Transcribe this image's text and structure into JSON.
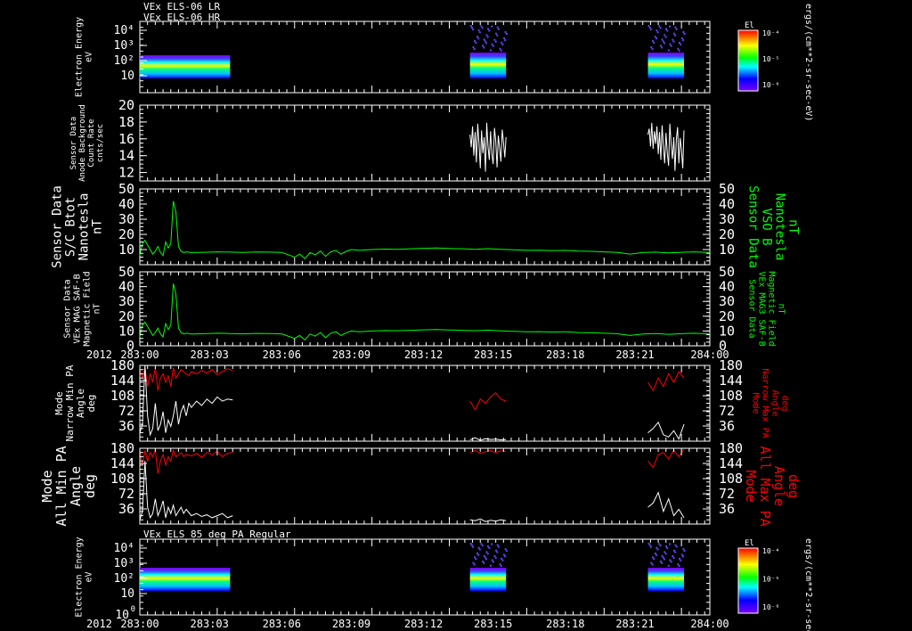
{
  "chart_data": [
    {
      "type": "heatmap",
      "titles": [
        "VEx ELS-06 LR",
        "VEx ELS-06 HR"
      ],
      "ylabel": [
        "Electron Energy",
        "eV"
      ],
      "yscale": "log",
      "yticks": [
        "10",
        "10²",
        "10³",
        "10⁴"
      ],
      "colorbar": {
        "label": "El",
        "ticks": [
          "10⁻⁴",
          "10⁻⁵",
          "10⁻⁶"
        ]
      },
      "colorbar_units": "ergs/(cm**2-sr-sec-eV)",
      "data_segments": [
        [
          0,
          35
        ],
        [
          128,
          142
        ],
        [
          197,
          211
        ]
      ]
    },
    {
      "type": "line",
      "ylabel": [
        "Sensor Data",
        "Anode Background",
        "Count Rate",
        "cnts/sec"
      ],
      "ylim": [
        11,
        20
      ],
      "yticks": [
        12,
        14,
        16,
        18,
        20
      ],
      "series": [
        {
          "color": "#ffffff",
          "x": [
            128,
            128.5,
            129,
            129.5,
            130,
            130.5,
            131,
            131.5,
            132,
            132.5,
            133,
            133.5,
            134,
            134.5,
            135,
            135.5,
            136,
            136.5,
            137,
            137.5,
            138,
            138.5,
            139,
            139.5,
            140,
            140.5,
            141,
            141.5,
            142
          ],
          "y": [
            16.5,
            15,
            17.5,
            14,
            16.8,
            13.2,
            17.8,
            15.5,
            12.5,
            17,
            14.3,
            16.2,
            12.1,
            17.9,
            15,
            13.5,
            16.9,
            14.2,
            13,
            17.3,
            15.8,
            12.6,
            16.4,
            14.9,
            13.3,
            17.1,
            15.6,
            13.8,
            16.2
          ]
        },
        {
          "color": "#ffffff",
          "x": [
            197,
            197.5,
            198,
            198.5,
            199,
            199.5,
            200,
            200.5,
            201,
            201.5,
            202,
            202.5,
            203,
            203.5,
            204,
            204.5,
            205,
            205.5,
            206,
            206.5,
            207,
            207.5,
            208,
            208.5,
            209,
            209.5,
            210,
            210.5,
            211
          ],
          "y": [
            16.5,
            17.2,
            15.1,
            17.9,
            14.8,
            16.9,
            15.4,
            17.5,
            14.2,
            16.8,
            13.5,
            17.6,
            15,
            13.1,
            16.7,
            14.4,
            12.8,
            17.8,
            15.3,
            13.6,
            16.2,
            12.2,
            15.9,
            17.4,
            13.1,
            16.1,
            14.7,
            12.5,
            17
          ]
        }
      ]
    },
    {
      "type": "line",
      "ylabel": [
        "Sensor Data",
        "S/C Btot",
        "Nanotesla",
        "nT"
      ],
      "ylabel_right": [
        "Sensor Data",
        "VSO B",
        "Nanotesla",
        "nT"
      ],
      "ylim": [
        0,
        50
      ],
      "yticks": [
        10,
        20,
        30,
        40,
        50
      ],
      "series": [
        {
          "color": "#00ff00",
          "x": [
            0,
            1,
            2,
            3,
            4,
            5,
            6,
            7,
            8,
            9,
            10,
            11,
            12,
            13,
            14,
            15,
            16,
            17,
            18,
            20,
            25,
            30,
            35,
            40,
            45,
            50,
            55,
            60,
            62,
            64,
            66,
            68,
            70,
            72,
            74,
            76,
            78,
            80,
            82,
            85,
            90,
            95,
            100,
            105,
            110,
            115,
            120,
            125,
            130,
            135,
            140,
            145,
            150,
            155,
            160,
            165,
            170,
            175,
            180,
            185,
            190,
            195,
            200,
            205,
            210,
            215,
            221
          ],
          "y": [
            6,
            14,
            16,
            13,
            10,
            7,
            9,
            12,
            8,
            6,
            15,
            11,
            14,
            42,
            35,
            12,
            9,
            8,
            8.5,
            8,
            8.2,
            8.5,
            8.3,
            8.1,
            8.4,
            8.3,
            8.1,
            5,
            7,
            4,
            8,
            6.5,
            9,
            5.5,
            8.5,
            9.5,
            7,
            8.8,
            10,
            9.5,
            10,
            10.3,
            10.2,
            10.5,
            10.8,
            11,
            10.7,
            10.5,
            10.2,
            10.6,
            10.1,
            9.8,
            9.5,
            9.6,
            9.3,
            9.5,
            9.0,
            8.8,
            8.5,
            8.2,
            7.0,
            8,
            8.3,
            7.8,
            8.2,
            8.5,
            8
          ]
        }
      ]
    },
    {
      "type": "line",
      "ylabel": [
        "Sensor Data",
        "VEx MAG SAF-B",
        "Magnetic Field",
        "nT"
      ],
      "ylabel_right": [
        "Sensor Data",
        "VEx MAG3 SAF-B",
        "Magnetic Field",
        "nT"
      ],
      "ylim": [
        0,
        50
      ],
      "yticks": [
        0,
        10,
        20,
        30,
        40,
        50
      ],
      "xticks": [
        "283:00",
        "283:03",
        "283:06",
        "283:09",
        "283:12",
        "283:15",
        "283:18",
        "283:21",
        "284:00"
      ],
      "year": "2012",
      "series": [
        {
          "color": "#00ff00",
          "x": [
            0,
            1,
            2,
            3,
            4,
            5,
            6,
            7,
            8,
            9,
            10,
            11,
            12,
            13,
            14,
            15,
            16,
            17,
            18,
            20,
            25,
            30,
            35,
            40,
            45,
            50,
            55,
            60,
            62,
            64,
            66,
            68,
            70,
            72,
            74,
            76,
            78,
            80,
            82,
            85,
            90,
            95,
            100,
            105,
            110,
            115,
            120,
            125,
            130,
            135,
            140,
            145,
            150,
            155,
            160,
            165,
            170,
            175,
            180,
            185,
            190,
            195,
            200,
            205,
            210,
            215,
            221
          ],
          "y": [
            6,
            14,
            16,
            13,
            10,
            7,
            9,
            12,
            8,
            6,
            15,
            11,
            14,
            42,
            35,
            12,
            9,
            8,
            8.5,
            8,
            8.2,
            8.5,
            8.3,
            8.1,
            8.4,
            8.3,
            8.1,
            5,
            7,
            4,
            8,
            6.5,
            9,
            5.5,
            8.5,
            9.5,
            7,
            8.8,
            10,
            9.5,
            10,
            10.3,
            10.2,
            10.5,
            10.8,
            11,
            10.7,
            10.5,
            10.2,
            10.6,
            10.1,
            9.8,
            9.5,
            9.6,
            9.3,
            9.5,
            9.0,
            8.8,
            8.5,
            8.2,
            7.0,
            8,
            8.3,
            7.8,
            8.2,
            8.5,
            8
          ]
        }
      ]
    },
    {
      "type": "line",
      "ylabel": [
        "Mode",
        "Narrow Min PA",
        "Angle",
        "deg"
      ],
      "ylabel_right": [
        "Mode",
        "Narrow Max PA",
        "Angle",
        "deg"
      ],
      "ylim": [
        0,
        180
      ],
      "yticks": [
        36,
        72,
        108,
        144,
        180
      ],
      "series": [
        {
          "color": "#ff0000",
          "x": [
            0,
            1,
            2,
            3,
            4,
            5,
            6,
            7,
            8,
            9,
            10,
            11,
            12,
            13,
            14,
            15,
            16,
            17,
            18,
            19,
            20,
            22,
            24,
            26,
            28,
            30,
            32,
            34,
            36
          ],
          "y": [
            170,
            150,
            175,
            130,
            160,
            140,
            175,
            120,
            150,
            160,
            140,
            155,
            130,
            175,
            150,
            160,
            170,
            165,
            160,
            155,
            165,
            160,
            168,
            162,
            170,
            158,
            165,
            172,
            168
          ]
        },
        {
          "color": "#ffffff",
          "x": [
            0,
            1,
            2,
            3,
            4,
            5,
            6,
            7,
            8,
            9,
            10,
            11,
            12,
            13,
            14,
            15,
            16,
            17,
            18,
            19,
            20,
            22,
            24,
            26,
            28,
            30,
            32,
            34,
            36
          ],
          "y": [
            20,
            40,
            180,
            60,
            15,
            30,
            90,
            25,
            40,
            70,
            20,
            50,
            35,
            60,
            95,
            40,
            70,
            85,
            60,
            90,
            80,
            95,
            85,
            100,
            90,
            105,
            95,
            100,
            98
          ]
        },
        {
          "color": "#ff0000",
          "x": [
            128,
            130,
            132,
            134,
            136,
            138,
            140,
            142
          ],
          "y": [
            95,
            75,
            100,
            90,
            105,
            115,
            100,
            95
          ]
        },
        {
          "color": "#ffffff",
          "x": [
            128,
            130,
            132,
            134,
            136,
            138,
            140,
            142
          ],
          "y": [
            3,
            8,
            2,
            6,
            4,
            5,
            3,
            4
          ]
        },
        {
          "color": "#ff0000",
          "x": [
            197,
            199,
            201,
            203,
            205,
            207,
            209,
            211
          ],
          "y": [
            140,
            120,
            150,
            130,
            160,
            140,
            165,
            150
          ]
        },
        {
          "color": "#ffffff",
          "x": [
            197,
            199,
            201,
            203,
            205,
            207,
            209,
            211
          ],
          "y": [
            20,
            30,
            45,
            15,
            10,
            25,
            5,
            40
          ]
        }
      ]
    },
    {
      "type": "line",
      "ylabel": [
        "Mode",
        "All Min PA",
        "Angle",
        "deg"
      ],
      "ylabel_right": [
        "Mode",
        "All Max PA",
        "Angle",
        "deg"
      ],
      "ylim": [
        0,
        180
      ],
      "yticks": [
        36,
        72,
        108,
        144,
        180
      ],
      "series": [
        {
          "color": "#ff0000",
          "x": [
            0,
            1,
            2,
            3,
            4,
            5,
            6,
            7,
            8,
            9,
            10,
            11,
            12,
            13,
            14,
            15,
            16,
            17,
            18,
            20,
            22,
            24,
            26,
            28,
            30,
            32,
            34,
            36
          ],
          "y": [
            175,
            140,
            175,
            150,
            170,
            160,
            175,
            120,
            150,
            165,
            140,
            160,
            150,
            175,
            160,
            165,
            170,
            160,
            165,
            162,
            168,
            158,
            170,
            165,
            172,
            160,
            168,
            170
          ]
        },
        {
          "color": "#ffffff",
          "x": [
            0,
            1,
            2,
            3,
            4,
            5,
            6,
            7,
            8,
            9,
            10,
            11,
            12,
            13,
            14,
            15,
            16,
            17,
            18,
            20,
            22,
            24,
            26,
            28,
            30,
            32,
            34,
            36
          ],
          "y": [
            10,
            30,
            150,
            40,
            15,
            25,
            60,
            20,
            35,
            55,
            15,
            40,
            25,
            45,
            20,
            30,
            40,
            25,
            35,
            20,
            25,
            18,
            22,
            15,
            20,
            25,
            15,
            20
          ]
        },
        {
          "color": "#ff0000",
          "x": [
            128,
            130,
            132,
            134,
            136,
            138,
            140,
            142
          ],
          "y": [
            170,
            175,
            168,
            172,
            175,
            170,
            174,
            172
          ]
        },
        {
          "color": "#ffffff",
          "x": [
            128,
            130,
            132,
            134,
            136,
            138,
            140,
            142
          ],
          "y": [
            10,
            8,
            12,
            6,
            9,
            7,
            10,
            8
          ]
        },
        {
          "color": "#ff0000",
          "x": [
            197,
            199,
            201,
            203,
            205,
            207,
            209,
            211
          ],
          "y": [
            150,
            135,
            165,
            170,
            155,
            175,
            160,
            178
          ]
        },
        {
          "color": "#ffffff",
          "x": [
            197,
            199,
            201,
            203,
            205,
            207,
            209,
            211
          ],
          "y": [
            40,
            50,
            75,
            30,
            60,
            20,
            35,
            15
          ]
        }
      ]
    },
    {
      "type": "heatmap",
      "titles": [
        "VEx ELS 85 deg PA Regular"
      ],
      "ylabel": [
        "Electron Energy",
        "eV"
      ],
      "yscale": "log",
      "yticks": [
        "10",
        "10²",
        "10³",
        "10⁴"
      ],
      "bottom_tick": "10",
      "bottom_sup": "0",
      "colorbar": {
        "label": "El",
        "ticks": [
          "10⁻⁴",
          "10⁻⁵",
          "10⁻⁶"
        ]
      },
      "colorbar_units": "ergs/(cm**2-sr-sec-eV)",
      "xticks": [
        "283:00",
        "283:03",
        "283:06",
        "283:09",
        "283:12",
        "283:15",
        "283:18",
        "283:21",
        "284:00"
      ],
      "year": "2012",
      "data_segments": [
        [
          0,
          35
        ],
        [
          128,
          142
        ],
        [
          197,
          211
        ]
      ]
    }
  ],
  "colors": {
    "bg": "#000000",
    "fg": "#ffffff",
    "green": "#00ff00",
    "red": "#ff0000"
  }
}
